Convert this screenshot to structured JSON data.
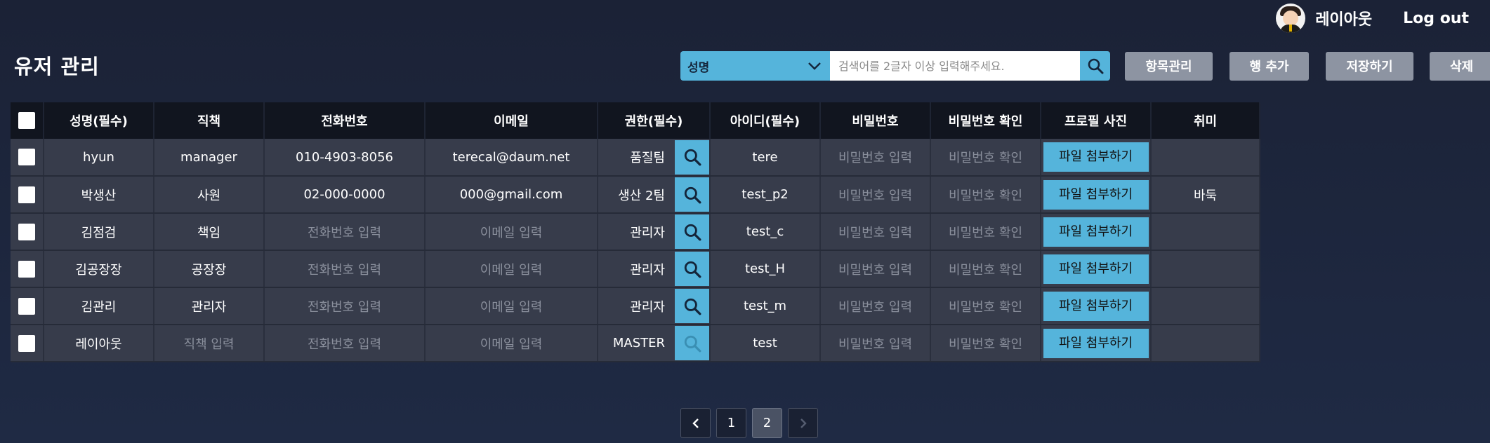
{
  "header": {
    "user_name": "레이아웃",
    "logout_label": "Log out"
  },
  "page": {
    "title": "유저 관리"
  },
  "search": {
    "field_selected": "성명",
    "placeholder": "검색어를 2글자 이상 입력해주세요."
  },
  "toolbar": {
    "manage_items_label": "항목관리",
    "add_row_label": "행 추가",
    "save_label": "저장하기",
    "delete_label": "삭제"
  },
  "table": {
    "headers": [
      "성명(필수)",
      "직책",
      "전화번호",
      "이메일",
      "권한(필수)",
      "아이디(필수)",
      "비밀번호",
      "비밀번호 확인",
      "프로필 사진",
      "취미"
    ],
    "file_button_label": "파일 첨부하기",
    "rows": [
      {
        "name": "hyun",
        "position": "manager",
        "position_ph": false,
        "phone": "010-4903-8056",
        "phone_ph": false,
        "email": "terecal@daum.net",
        "email_ph": false,
        "role": "품질팀",
        "id": "tere",
        "password": "비밀번호 입력",
        "password_confirm": "비밀번호 확인",
        "hobby": ""
      },
      {
        "name": "박생산",
        "position": "사원",
        "position_ph": false,
        "phone": "02-000-0000",
        "phone_ph": false,
        "email": "000@gmail.com",
        "email_ph": false,
        "role": "생산 2팀",
        "id": "test_p2",
        "password": "비밀번호 입력",
        "password_confirm": "비밀번호 확인",
        "hobby": "바둑"
      },
      {
        "name": "김점검",
        "position": "책임",
        "position_ph": false,
        "phone": "전화번호 입력",
        "phone_ph": true,
        "email": "이메일 입력",
        "email_ph": true,
        "role": "관리자",
        "id": "test_c",
        "password": "비밀번호 입력",
        "password_confirm": "비밀번호 확인",
        "hobby": ""
      },
      {
        "name": "김공장장",
        "position": "공장장",
        "position_ph": false,
        "phone": "전화번호 입력",
        "phone_ph": true,
        "email": "이메일 입력",
        "email_ph": true,
        "role": "관리자",
        "id": "test_H",
        "password": "비밀번호 입력",
        "password_confirm": "비밀번호 확인",
        "hobby": ""
      },
      {
        "name": "김관리",
        "position": "관리자",
        "position_ph": false,
        "phone": "전화번호 입력",
        "phone_ph": true,
        "email": "이메일 입력",
        "email_ph": true,
        "role": "관리자",
        "id": "test_m",
        "password": "비밀번호 입력",
        "password_confirm": "비밀번호 확인",
        "hobby": ""
      },
      {
        "name": "레이아웃",
        "position": "직책 입력",
        "position_ph": true,
        "phone": "전화번호 입력",
        "phone_ph": true,
        "email": "이메일 입력",
        "email_ph": true,
        "role": "MASTER",
        "role_disabled": true,
        "id": "test",
        "password": "비밀번호 입력",
        "password_confirm": "비밀번호 확인",
        "hobby": ""
      }
    ]
  },
  "pagination": {
    "pages": [
      "1",
      "2"
    ],
    "current": "2"
  },
  "colors": {
    "accent": "#55b4db",
    "button_gray": "#8d94a2",
    "header_bg": "#11151f",
    "row_bg": "#373c4b"
  }
}
